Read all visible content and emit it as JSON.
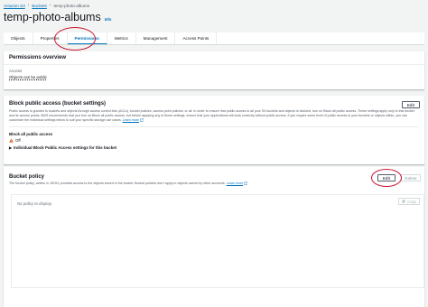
{
  "breadcrumb": {
    "root": "Amazon S3",
    "section": "Buckets",
    "current": "temp-photo-albums"
  },
  "page": {
    "title": "temp-photo-albums",
    "info": "Info"
  },
  "tabs": [
    {
      "label": "Objects"
    },
    {
      "label": "Properties"
    },
    {
      "label": "Permissions"
    },
    {
      "label": "Metrics"
    },
    {
      "label": "Management"
    },
    {
      "label": "Access Points"
    }
  ],
  "active_tab": "Permissions",
  "permissions_overview": {
    "title": "Permissions overview",
    "access_label": "Access",
    "access_value": "Objects can be public"
  },
  "block_public_access": {
    "title": "Block public access (bucket settings)",
    "edit_label": "Edit",
    "description": "Public access is granted to buckets and objects through access control lists (ACLs), bucket policies, access point policies, or all. In order to ensure that public access to all your S3 buckets and objects is blocked, turn on Block all public access. These settings apply only to this bucket and its access points. AWS recommends that you turn on Block all public access, but before applying any of these settings, ensure that your applications will work correctly without public access. If you require some level of public access to your buckets or objects within, you can customize the individual settings below to suit your specific storage use cases.",
    "learn_more": "Learn more",
    "block_all_label": "Block all public access",
    "status": "Off",
    "expander_label": "Individual Block Public Access settings for this bucket"
  },
  "bucket_policy": {
    "title": "Bucket policy",
    "edit_label": "Edit",
    "delete_label": "Delete",
    "description": "The bucket policy, written in JSON, provides access to the objects stored in the bucket. Bucket policies don't apply to objects owned by other accounts.",
    "learn_more": "Learn more",
    "empty_text": "No policy to display.",
    "copy_label": "Copy"
  },
  "colors": {
    "link": "#0073bb",
    "annotation": "#c8102e",
    "warning": "#d45b07"
  }
}
